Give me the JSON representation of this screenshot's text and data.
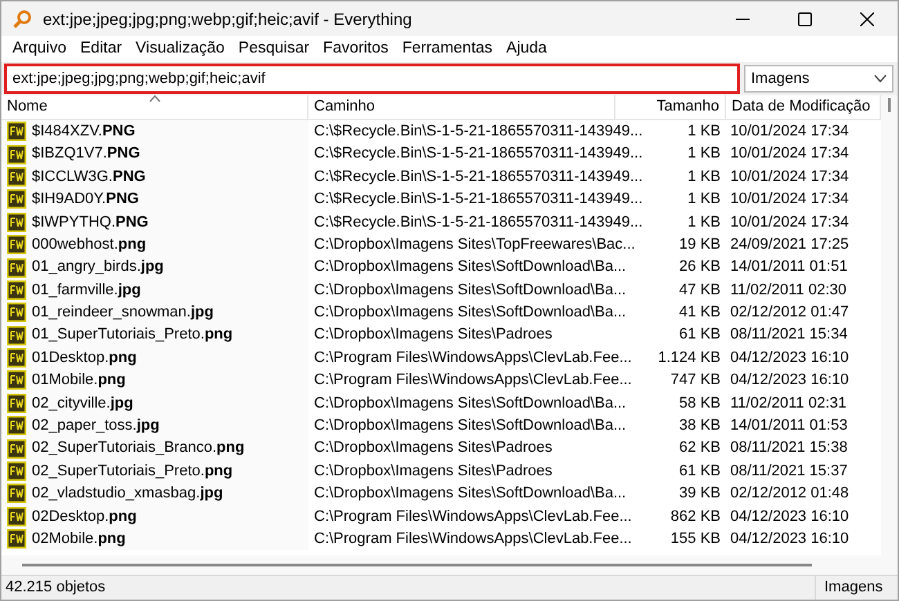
{
  "window": {
    "title": "ext:jpe;jpeg;jpg;png;webp;gif;heic;avif - Everything"
  },
  "menu": [
    "Arquivo",
    "Editar",
    "Visualização",
    "Pesquisar",
    "Favoritos",
    "Ferramentas",
    "Ajuda"
  ],
  "search": {
    "value": "ext:jpe;jpeg;jpg;png;webp;gif;heic;avif",
    "highlighted": true
  },
  "filter": {
    "value": "Imagens"
  },
  "table": {
    "columns": [
      "Nome",
      "Caminho",
      "Tamanho",
      "Data de Modificação"
    ],
    "rows": [
      {
        "name": "$I484XZV.**PNG**",
        "path": "C:\\$Recycle.Bin\\S-1-5-21-1865570311-143949...",
        "size": "1 KB",
        "date": "10/01/2024 17:34"
      },
      {
        "name": "$IBZQ1V7.**PNG**",
        "path": "C:\\$Recycle.Bin\\S-1-5-21-1865570311-143949...",
        "size": "1 KB",
        "date": "10/01/2024 17:34"
      },
      {
        "name": "$ICCLW3G.**PNG**",
        "path": "C:\\$Recycle.Bin\\S-1-5-21-1865570311-143949...",
        "size": "1 KB",
        "date": "10/01/2024 17:34"
      },
      {
        "name": "$IH9AD0Y.**PNG**",
        "path": "C:\\$Recycle.Bin\\S-1-5-21-1865570311-143949...",
        "size": "1 KB",
        "date": "10/01/2024 17:34"
      },
      {
        "name": "$IWPYTHQ.**PNG**",
        "path": "C:\\$Recycle.Bin\\S-1-5-21-1865570311-143949...",
        "size": "1 KB",
        "date": "10/01/2024 17:34"
      },
      {
        "name": "000webhost.**png**",
        "path": "C:\\Dropbox\\Imagens Sites\\TopFreewares\\Bac...",
        "size": "19 KB",
        "date": "24/09/2021 17:25"
      },
      {
        "name": "01_angry_birds.**jpg**",
        "path": "C:\\Dropbox\\Imagens Sites\\SoftDownload\\Ba...",
        "size": "26 KB",
        "date": "14/01/2011 01:51"
      },
      {
        "name": "01_farmville.**jpg**",
        "path": "C:\\Dropbox\\Imagens Sites\\SoftDownload\\Ba...",
        "size": "47 KB",
        "date": "11/02/2011 02:30"
      },
      {
        "name": "01_reindeer_snowman.**jpg**",
        "path": "C:\\Dropbox\\Imagens Sites\\SoftDownload\\Ba...",
        "size": "41 KB",
        "date": "02/12/2012 01:47"
      },
      {
        "name": "01_SuperTutoriais_Preto.**png**",
        "path": "C:\\Dropbox\\Imagens Sites\\Padroes",
        "size": "61 KB",
        "date": "08/11/2021 15:34"
      },
      {
        "name": "01Desktop.**png**",
        "path": "C:\\Program Files\\WindowsApps\\ClevLab.Fee...",
        "size": "1.124 KB",
        "date": "04/12/2023 16:10"
      },
      {
        "name": "01Mobile.**png**",
        "path": "C:\\Program Files\\WindowsApps\\ClevLab.Fee...",
        "size": "747 KB",
        "date": "04/12/2023 16:10"
      },
      {
        "name": "02_cityville.**jpg**",
        "path": "C:\\Dropbox\\Imagens Sites\\SoftDownload\\Ba...",
        "size": "58 KB",
        "date": "11/02/2011 02:31"
      },
      {
        "name": "02_paper_toss.**jpg**",
        "path": "C:\\Dropbox\\Imagens Sites\\SoftDownload\\Ba...",
        "size": "38 KB",
        "date": "14/01/2011 01:53"
      },
      {
        "name": "02_SuperTutoriais_Branco.**png**",
        "path": "C:\\Dropbox\\Imagens Sites\\Padroes",
        "size": "62 KB",
        "date": "08/11/2021 15:38"
      },
      {
        "name": "02_SuperTutoriais_Preto.**png**",
        "path": "C:\\Dropbox\\Imagens Sites\\Padroes",
        "size": "61 KB",
        "date": "08/11/2021 15:37"
      },
      {
        "name": "02_vladstudio_xmasbag.**jpg**",
        "path": "C:\\Dropbox\\Imagens Sites\\SoftDownload\\Ba...",
        "size": "39 KB",
        "date": "02/12/2012 01:48"
      },
      {
        "name": "02Desktop.**png**",
        "path": "C:\\Program Files\\WindowsApps\\ClevLab.Fee...",
        "size": "862 KB",
        "date": "04/12/2023 16:10"
      },
      {
        "name": "02Mobile.**png**",
        "path": "C:\\Program Files\\WindowsApps\\ClevLab.Fee...",
        "size": "155 KB",
        "date": "04/12/2023 16:10"
      }
    ]
  },
  "status_bar": {
    "count": "42.215 objetos",
    "filter": "Imagens"
  }
}
